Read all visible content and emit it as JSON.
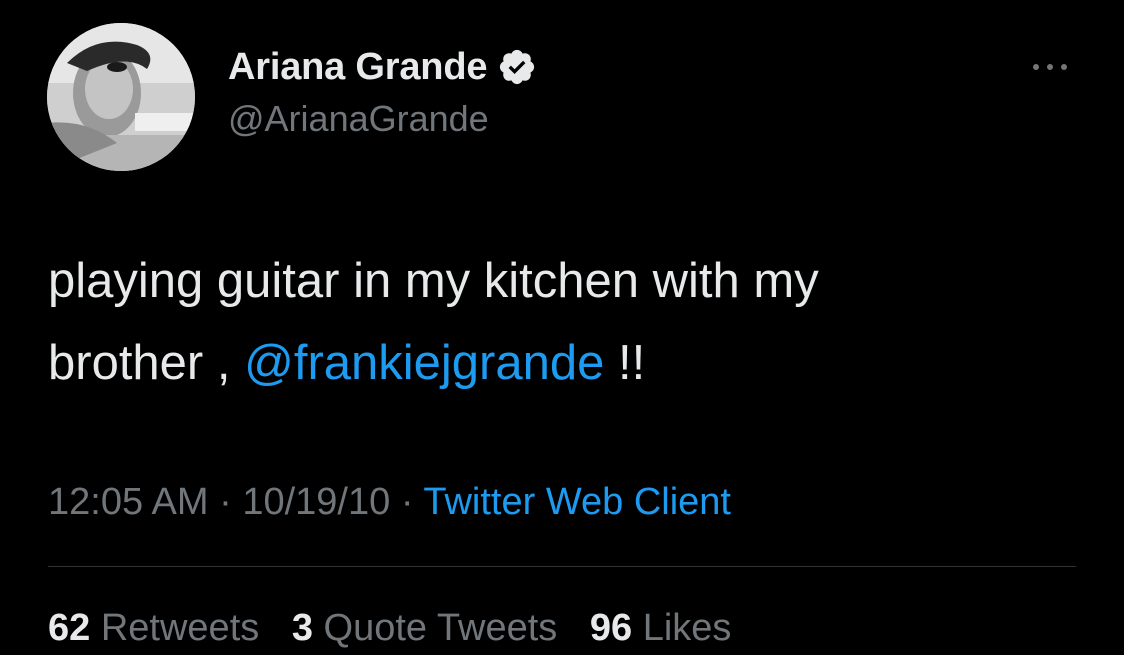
{
  "author": {
    "display_name": "Ariana Grande",
    "handle": "@ArianaGrande",
    "verified": true,
    "avatar_icon": "profile-photo-grayscale"
  },
  "tweet": {
    "text_line1": "playing guitar in my kitchen with my",
    "text_line2_prefix": "brother , ",
    "mention": "@frankiejgrande",
    "text_line2_suffix": " !!"
  },
  "meta": {
    "time": "12:05 AM",
    "separator1": " · ",
    "date": "10/19/10",
    "separator2": " · ",
    "source": "Twitter Web Client"
  },
  "stats": {
    "retweets_count": "62",
    "retweets_label": "Retweets",
    "quotes_count": "3",
    "quotes_label": "Quote Tweets",
    "likes_count": "96",
    "likes_label": "Likes"
  },
  "colors": {
    "background": "#000000",
    "primary_text": "#e7e9ea",
    "secondary_text": "#71767b",
    "accent": "#1d9bf0",
    "divider": "#2f3336"
  },
  "icons": {
    "verified": "verified-badge-icon",
    "more": "more-options-icon"
  }
}
